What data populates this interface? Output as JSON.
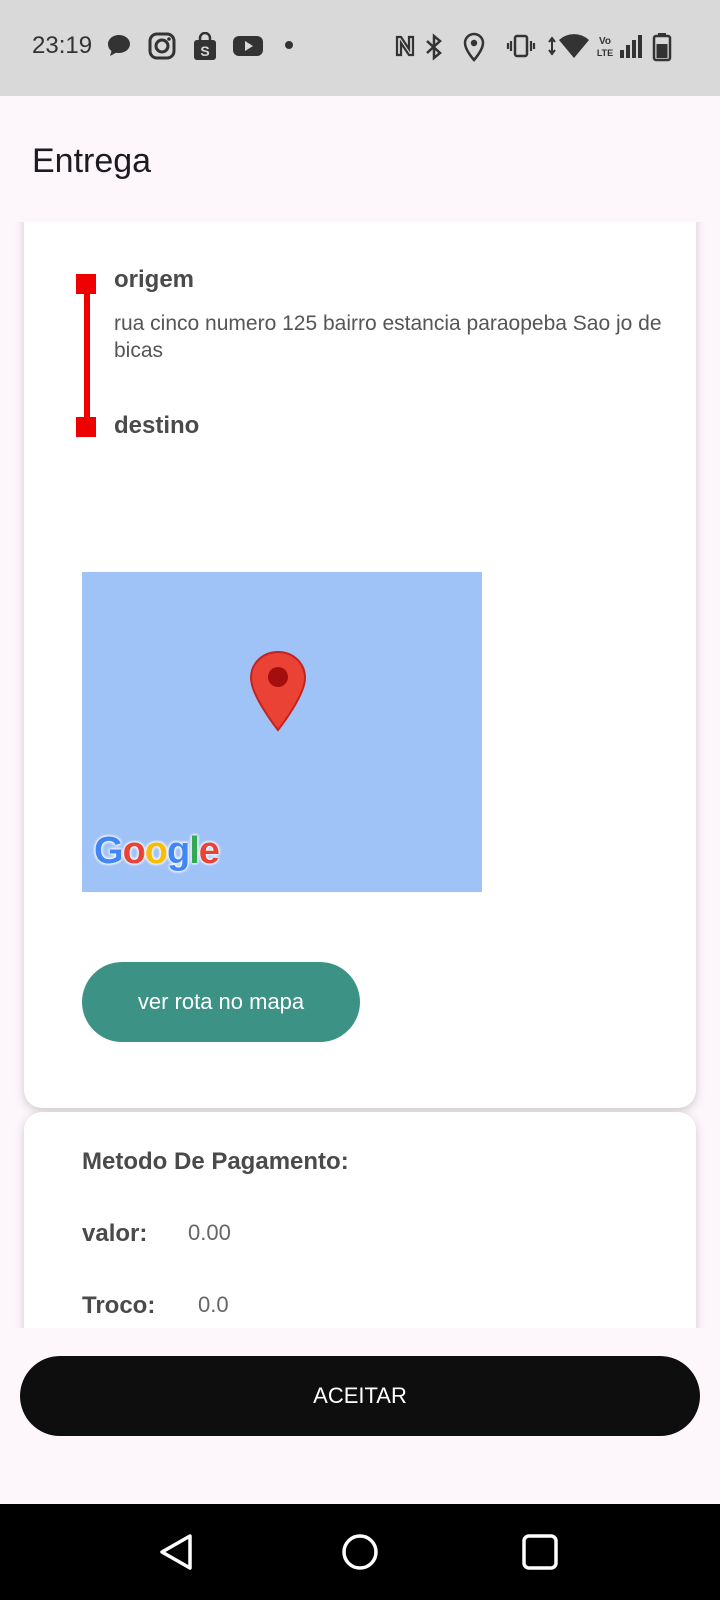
{
  "status_bar": {
    "time": "23:19",
    "icons": [
      "chat-icon",
      "instagram-icon",
      "shopping-bag-icon",
      "youtube-icon",
      "dot-icon",
      "nfc-icon",
      "bluetooth-icon",
      "location-icon",
      "vibrate-icon",
      "wifi-icon",
      "volte-icon",
      "signal-icon",
      "battery-icon"
    ]
  },
  "app_bar": {
    "title": "Entrega"
  },
  "route": {
    "origin_label": "origem",
    "origin_address": "rua cinco numero 125 bairro estancia paraopeba Sao jo de bicas",
    "destination_label": "destino",
    "line_color": "#ee0000"
  },
  "map": {
    "provider_logo": [
      "G",
      "o",
      "o",
      "g",
      "l",
      "e"
    ],
    "background_color": "#9fc2f7",
    "pin_color": "#ea4335"
  },
  "route_button": {
    "label": "ver rota no mapa",
    "color": "#3d9286"
  },
  "payment": {
    "title": "Metodo De Pagamento:",
    "valor_label": "valor:",
    "valor_value": "0.00",
    "troco_label": "Troco:",
    "troco_value": "0.0"
  },
  "accept_button": {
    "label": "ACEITAR",
    "color": "#0e0e0e"
  },
  "nav_bar": {
    "buttons": [
      "back-icon",
      "home-icon",
      "recents-icon"
    ]
  }
}
